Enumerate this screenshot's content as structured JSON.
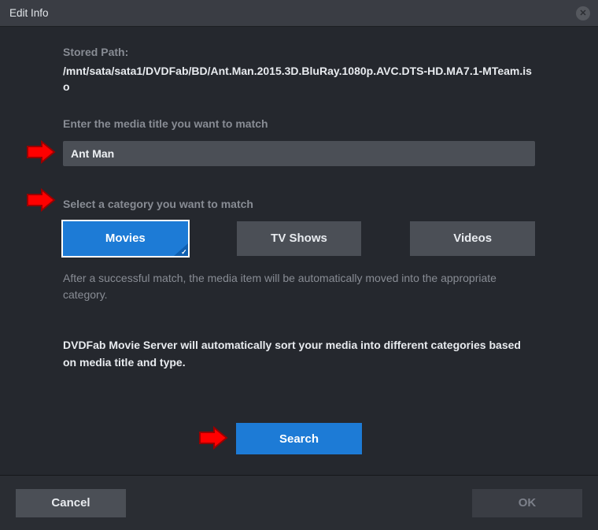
{
  "titlebar": {
    "title": "Edit Info"
  },
  "storedPath": {
    "label": "Stored Path:",
    "value": "/mnt/sata/sata1/DVDFab/BD/Ant.Man.2015.3D.BluRay.1080p.AVC.DTS-HD.MA7.1-MTeam.iso"
  },
  "titleSection": {
    "label": "Enter the media title you want to match",
    "value": "Ant Man"
  },
  "categorySection": {
    "label": "Select a category you want to match",
    "options": [
      {
        "label": "Movies",
        "selected": true
      },
      {
        "label": "TV Shows",
        "selected": false
      },
      {
        "label": "Videos",
        "selected": false
      }
    ],
    "helper": "After a successful match, the media item will be automatically moved into the appropriate category."
  },
  "info": "DVDFab Movie Server will automatically sort your media into different categories based on media title and type.",
  "buttons": {
    "search": "Search",
    "cancel": "Cancel",
    "ok": "OK"
  },
  "colors": {
    "accent": "#1d7bd6",
    "panel": "#4b4f56",
    "bg": "#25282e"
  }
}
